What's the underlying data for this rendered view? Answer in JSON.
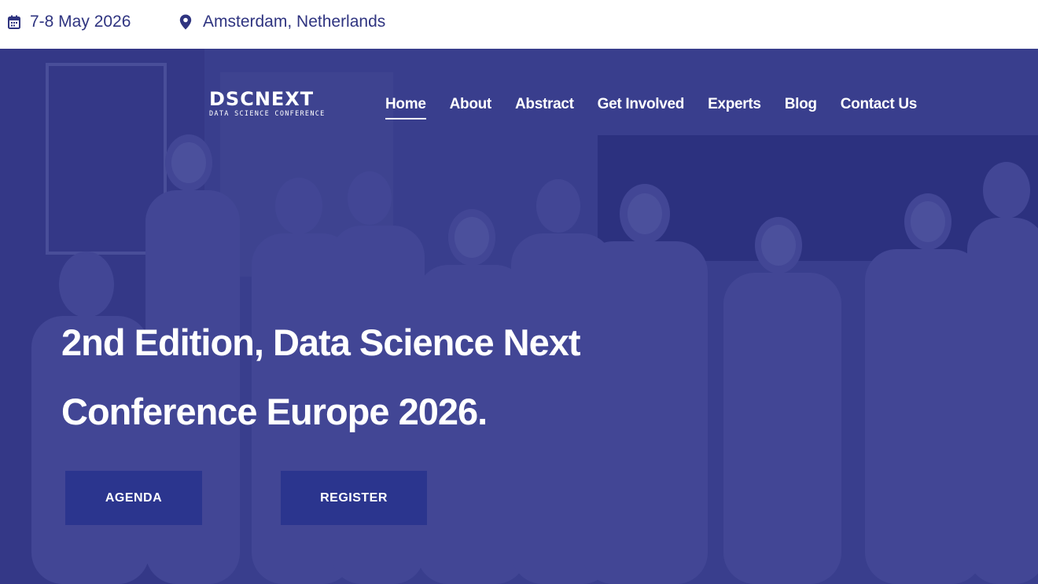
{
  "topbar": {
    "date": "7-8 May 2026",
    "location": "Amsterdam, Netherlands",
    "icons": {
      "date": "calendar-icon",
      "location": "map-pin-icon"
    },
    "text_color": "#2f3480"
  },
  "logo": {
    "wordmark": "DSCNEXT",
    "tagline": "DATA SCIENCE CONFERENCE"
  },
  "nav": {
    "items": [
      {
        "label": "Home",
        "active": true
      },
      {
        "label": "About",
        "active": false
      },
      {
        "label": "Abstract",
        "active": false
      },
      {
        "label": "Get Involved",
        "active": false
      },
      {
        "label": "Experts",
        "active": false
      },
      {
        "label": "Blog",
        "active": false
      },
      {
        "label": "Contact Us",
        "active": false
      }
    ]
  },
  "hero": {
    "headline_line1": "2nd Edition, Data Science Next",
    "headline_line2": "Conference Europe 2026.",
    "overlay_color": "#2c328c",
    "buttons": {
      "agenda": "AGENDA",
      "register": "REGISTER"
    },
    "button_color": "#2b358e"
  }
}
